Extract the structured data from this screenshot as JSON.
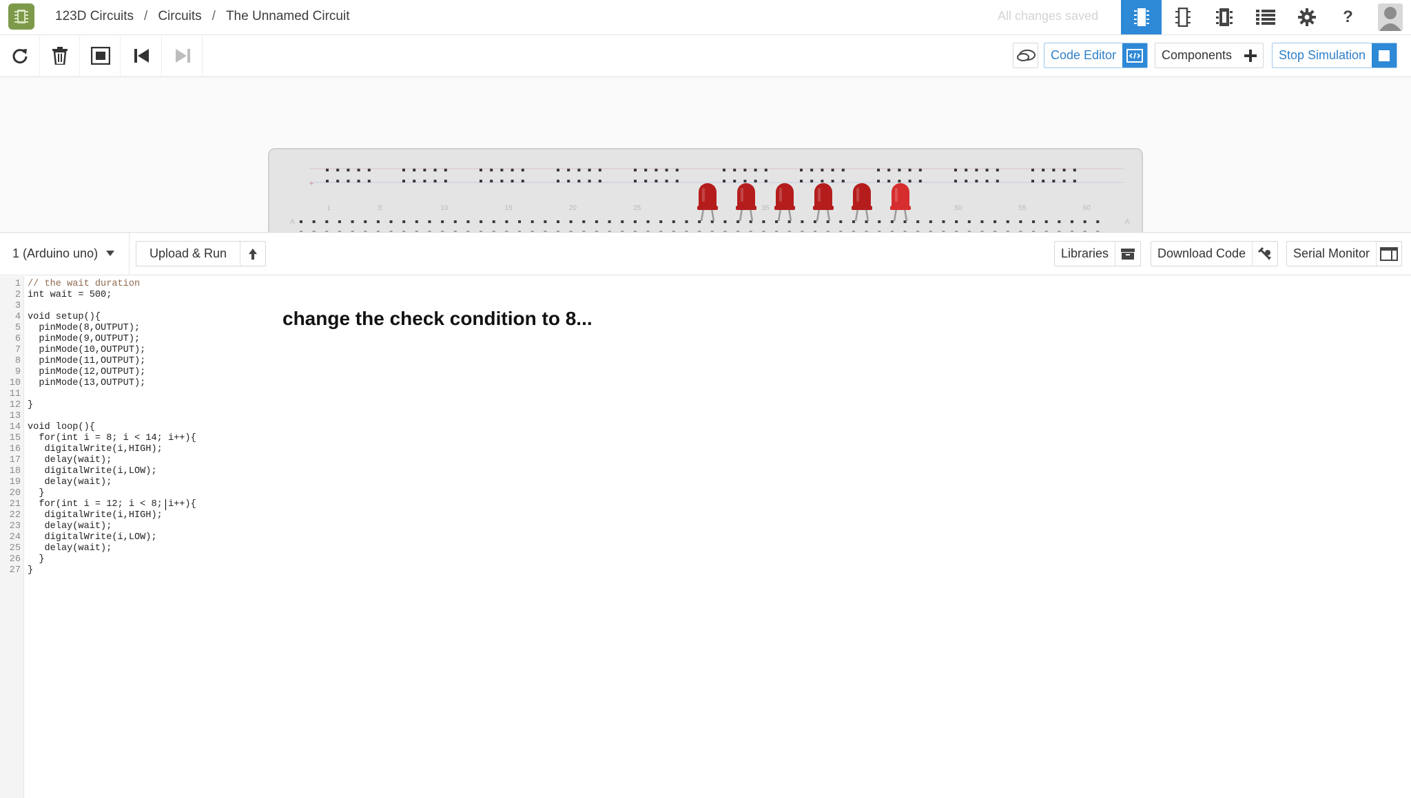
{
  "app": {
    "logo_icon": "circuit-chip-icon",
    "accent_color": "#2e89d6"
  },
  "breadcrumb": {
    "items": [
      "123D Circuits",
      "Circuits",
      "The Unnamed Circuit"
    ],
    "separator": "/"
  },
  "header": {
    "save_status": "All changes saved",
    "view_buttons": [
      {
        "name": "breadboard-view-icon",
        "active": true
      },
      {
        "name": "schematic-view-icon",
        "active": false
      },
      {
        "name": "pcb-view-icon",
        "active": false
      },
      {
        "name": "component-list-icon",
        "active": false
      },
      {
        "name": "settings-icon",
        "active": false
      },
      {
        "name": "help-icon",
        "active": false
      },
      {
        "name": "user-avatar-icon",
        "active": false
      }
    ],
    "help_label": "?"
  },
  "toolbar": {
    "tools": [
      "rotate-icon",
      "delete-icon",
      "fit-view-icon",
      "step-back-icon",
      "step-forward-icon"
    ],
    "code_editor_label": "Code Editor",
    "components_label": "Components",
    "stop_simulation_label": "Stop Simulation"
  },
  "breadboard": {
    "column_numbers": [
      "1",
      "5",
      "10",
      "15",
      "20",
      "25",
      "30",
      "35",
      "40",
      "45",
      "50",
      "55",
      "60"
    ],
    "row_letter_left": "A",
    "row_letter_right": "A",
    "rail_marker": "+",
    "leds": {
      "count": 6,
      "color": "#b51d1d",
      "lit_index": 5,
      "lit_color": "#d62e2e"
    }
  },
  "code_toolbar": {
    "board_select": "1 (Arduino uno)",
    "upload_run_label": "Upload & Run",
    "libraries_label": "Libraries",
    "download_code_label": "Download Code",
    "serial_monitor_label": "Serial Monitor"
  },
  "code": {
    "lines": [
      "// the wait duration",
      "int wait = 500;",
      "",
      "void setup(){",
      "  pinMode(8,OUTPUT);",
      "  pinMode(9,OUTPUT);",
      "  pinMode(10,OUTPUT);",
      "  pinMode(11,OUTPUT);",
      "  pinMode(12,OUTPUT);",
      "  pinMode(13,OUTPUT);",
      "",
      "}",
      "",
      "void loop(){",
      "  for(int i = 8; i < 14; i++){",
      "   digitalWrite(i,HIGH);",
      "   delay(wait);",
      "   digitalWrite(i,LOW);",
      "   delay(wait);",
      "  }",
      "  for(int i = 12; i < 8; i++){",
      "   digitalWrite(i,HIGH);",
      "   delay(wait);",
      "   digitalWrite(i,LOW);",
      "   delay(wait);",
      "  }",
      "}"
    ],
    "cursor_line": 21
  },
  "annotation": "change the check condition to 8..."
}
